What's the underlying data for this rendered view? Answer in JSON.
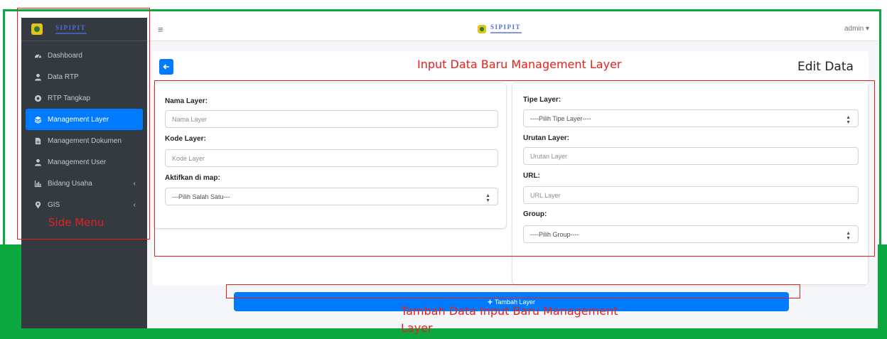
{
  "brand": {
    "name": "SIPIPIT"
  },
  "sidebar": {
    "items": [
      {
        "label": "Dashboard",
        "icon": "dashboard-icon",
        "active": false
      },
      {
        "label": "Data RTP",
        "icon": "user-icon",
        "active": false
      },
      {
        "label": "RTP Tangkap",
        "icon": "circle-icon",
        "active": false
      },
      {
        "label": "Management Layer",
        "icon": "layers-icon",
        "active": true
      },
      {
        "label": "Management Dokumen",
        "icon": "file-icon",
        "active": false
      },
      {
        "label": "Management User",
        "icon": "user-icon",
        "active": false
      },
      {
        "label": "Bidang Usaha",
        "icon": "chart-bar-icon",
        "active": false,
        "chevron": "‹"
      },
      {
        "label": "GIS",
        "icon": "map-marker-icon",
        "active": false,
        "chevron": "‹"
      }
    ]
  },
  "topbar": {
    "menu_icon": "≡",
    "user": "admin ▾"
  },
  "page": {
    "back_icon": "arrow-left-icon",
    "title": "Edit Data"
  },
  "form": {
    "nama_layer": {
      "label": "Nama Layer:",
      "placeholder": "Nama Layer"
    },
    "kode_layer": {
      "label": "Kode Layer:",
      "placeholder": "Kode Layer"
    },
    "aktifkan": {
      "label": "Aktifkan di map:",
      "value": "---Pilih Salah Satu---"
    },
    "tipe_layer": {
      "label": "Tipe Layer:",
      "value": "----Pilih Tipe Layer----"
    },
    "urutan_layer": {
      "label": "Urutan Layer:",
      "placeholder": "Urutan Layer"
    },
    "url": {
      "label": "URL:",
      "placeholder": "URL Layer"
    },
    "group": {
      "label": "Group:",
      "value": "----Pilih Group----"
    }
  },
  "submit": {
    "label": "Tambah Layer"
  },
  "annotations": {
    "side_menu": "Side Menu",
    "input_data": "Input Data  Baru Management Layer",
    "tambah_line1": "Tambah Data  Input Baru Management",
    "tambah_line2": "Layer"
  },
  "colors": {
    "accent": "#007bff",
    "sidebar": "#343a40",
    "annotation": "#e5211d",
    "frame": "#0aa83f"
  }
}
